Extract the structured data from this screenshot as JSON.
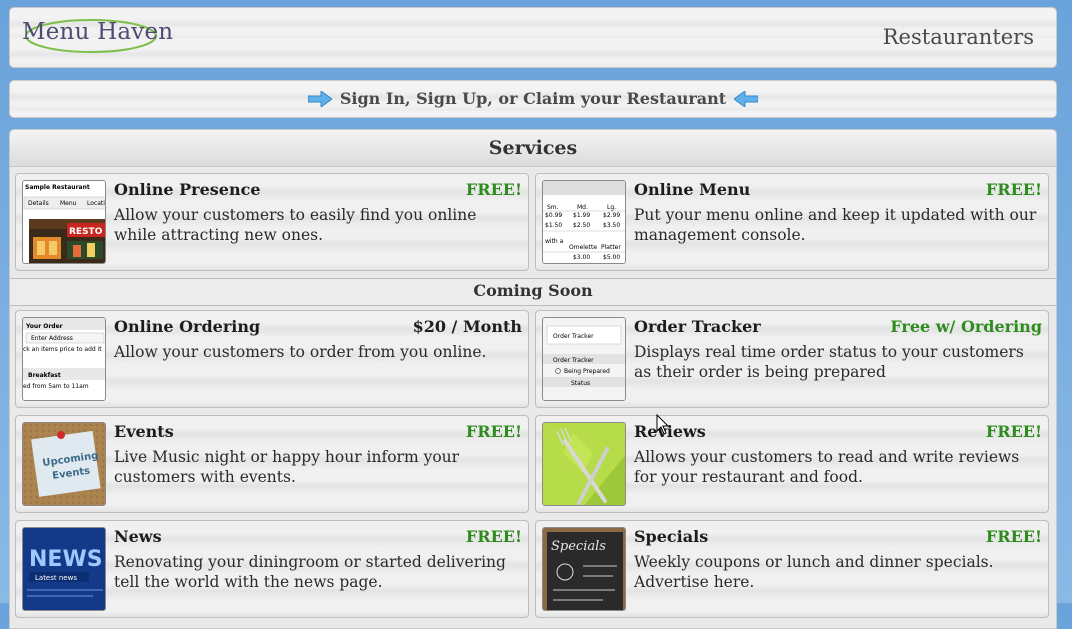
{
  "header": {
    "logo_text": "Menu Haven",
    "right_link": "Restauranters"
  },
  "signin": {
    "label": "Sign In, Sign Up, or Claim your Restaurant"
  },
  "services": {
    "title": "Services",
    "coming_soon_title": "Coming Soon",
    "cards": [
      {
        "title": "Online Presence",
        "price": "FREE!",
        "desc": "Allow your customers to easily find you online while attracting new ones."
      },
      {
        "title": "Online Menu",
        "price": "FREE!",
        "desc": "Put your menu online and keep it updated with our management console."
      },
      {
        "title": "Online Ordering",
        "price": "$20 / Month",
        "desc": "Allow your customers to order from you online."
      },
      {
        "title": "Order Tracker",
        "price": "Free w/ Ordering",
        "desc": "Displays real time order status to your customers as their order is being prepared"
      },
      {
        "title": "Events",
        "price": "FREE!",
        "desc": "Live Music night or happy hour inform your customers with events."
      },
      {
        "title": "Reviews",
        "price": "FREE!",
        "desc": "Allows your customers to read and write reviews for your restaurant and food."
      },
      {
        "title": "News",
        "price": "FREE!",
        "desc": "Renovating your diningroom or started delivering tell the world with the news page."
      },
      {
        "title": "Specials",
        "price": "FREE!",
        "desc": "Weekly coupons or lunch and dinner specials. Advertise here."
      }
    ]
  },
  "thumbs": {
    "presence": {
      "title": "Sample Restaurant",
      "tabs": [
        "Details",
        "Menu",
        "Locati"
      ],
      "sign": "RESTO"
    },
    "menu": {
      "header": [
        "Sm.",
        "Md.",
        "Lg."
      ],
      "row1": [
        "$0.99",
        "$1.99",
        "$2.99"
      ],
      "row2": [
        "$1.50",
        "$2.50",
        "$3.50"
      ],
      "label": "with a",
      "header2": [
        "Omelette",
        "Platter"
      ],
      "row3": [
        "$3.00",
        "$5.00"
      ]
    },
    "ordering": {
      "title": "Your Order",
      "field": "Enter Address",
      "hint": "ck an items price to add it",
      "section": "Breakfast",
      "time": "ed from 5am to 11am"
    },
    "tracker": {
      "tab": "Order Tracker",
      "title": "Order Tracker",
      "status": "Being Prepared",
      "label": "Status"
    },
    "events": {
      "note_line1": "Upcoming",
      "note_line2": "Events"
    },
    "news": {
      "big": "NEWS",
      "small": "Latest news"
    },
    "specials": {
      "board": "Specials"
    }
  },
  "colors": {
    "free_green": "#2e8b1e",
    "logo": "#4d4b73",
    "arrow_blue": "#4aa3e8"
  }
}
